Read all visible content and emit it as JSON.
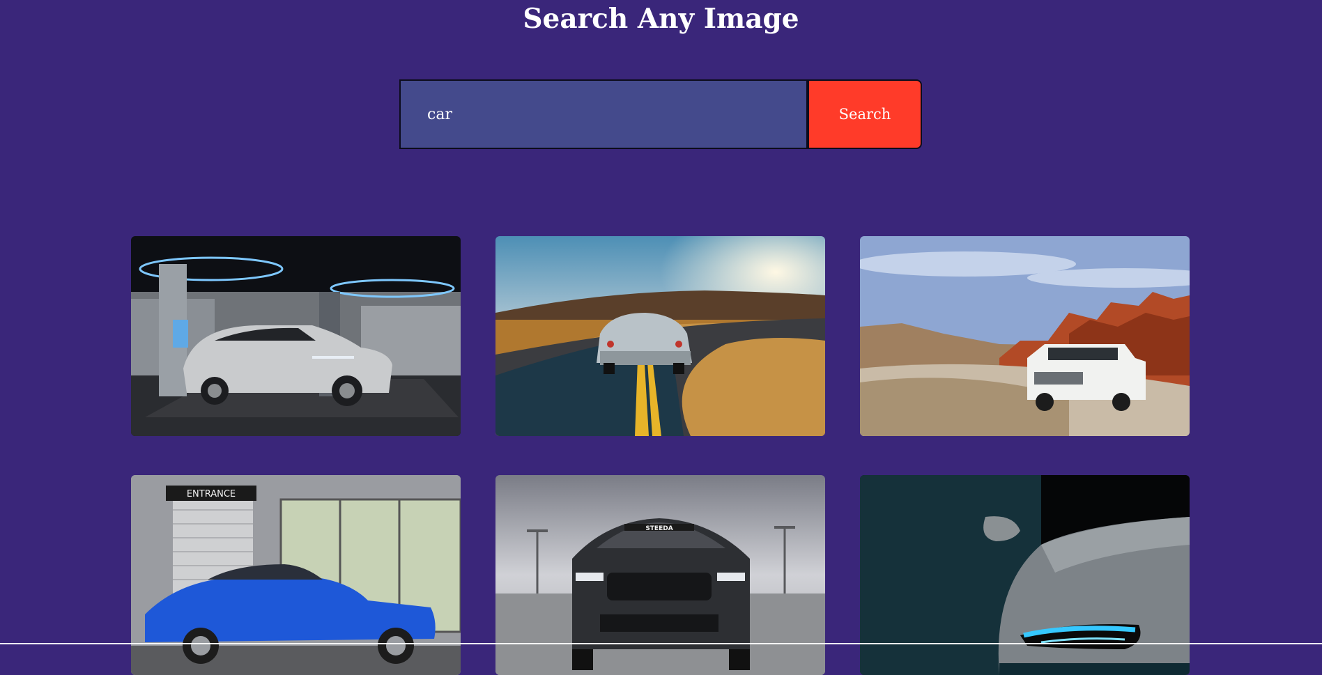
{
  "header": {
    "title": "Search Any Image"
  },
  "search": {
    "value": "car",
    "button_label": "Search"
  },
  "results": [
    {
      "name": "result-image-1",
      "icon": "ev-charging-car-image"
    },
    {
      "name": "result-image-2",
      "icon": "sports-car-road-image"
    },
    {
      "name": "result-image-3",
      "icon": "white-suv-desert-image"
    },
    {
      "name": "result-image-4",
      "icon": "blue-coupe-entrance-image"
    },
    {
      "name": "result-image-5",
      "icon": "black-muscle-car-image"
    },
    {
      "name": "result-image-6",
      "icon": "headlight-closeup-image"
    }
  ],
  "image_text": {
    "entrance_sign": "ENTRANCE",
    "windshield_banner": "STEEDA"
  },
  "colors": {
    "background": "#3a267a",
    "input_bg": "#444a8c",
    "button": "#ff3b29"
  }
}
